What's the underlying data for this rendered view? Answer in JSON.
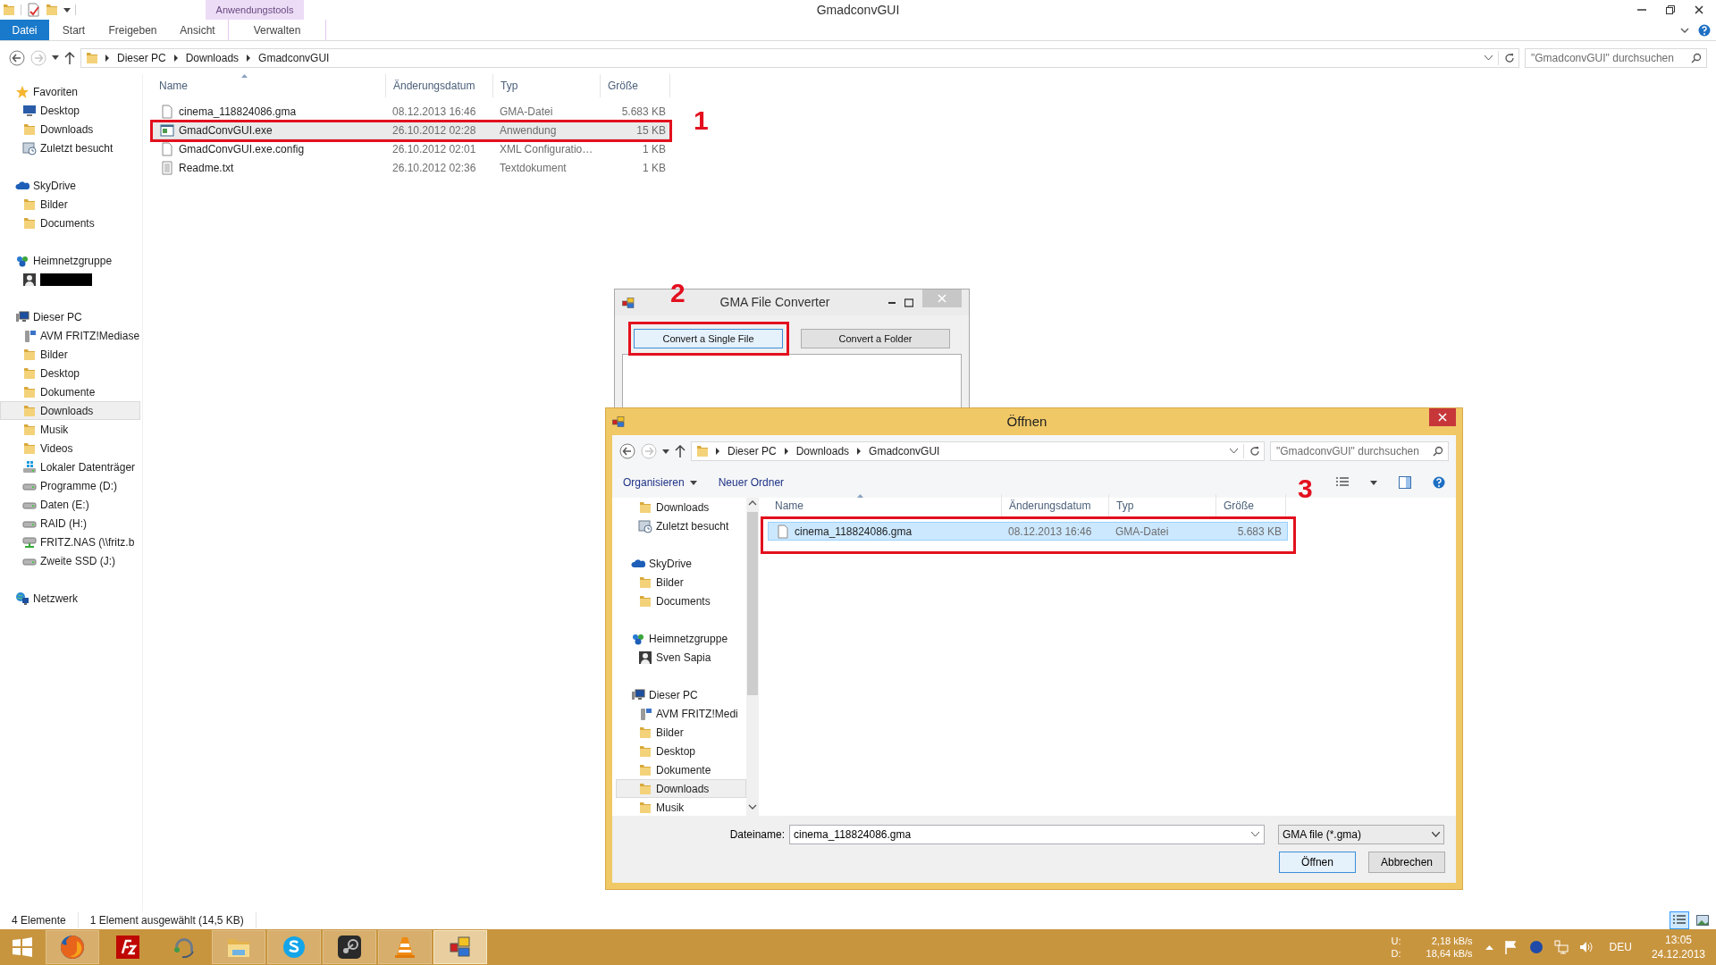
{
  "window": {
    "title": "GmadconvGUI",
    "context_group": "Anwendungstools"
  },
  "ribbon_tabs": [
    {
      "label": "Datei",
      "kind": "file",
      "selected": false
    },
    {
      "label": "Start",
      "kind": "tab",
      "selected": false
    },
    {
      "label": "Freigeben",
      "kind": "tab",
      "selected": false
    },
    {
      "label": "Ansicht",
      "kind": "tab",
      "selected": false
    },
    {
      "label": "Verwalten",
      "kind": "context",
      "selected": false
    }
  ],
  "address": {
    "path": [
      "Dieser PC",
      "Downloads",
      "GmadconvGUI"
    ],
    "search_placeholder": "\"GmadconvGUI\" durchsuchen"
  },
  "sidebar": [
    {
      "label": "Favoriten",
      "kind": "star",
      "selected": false,
      "children": [
        {
          "label": "Desktop",
          "kind": "desktop",
          "selected": false
        },
        {
          "label": "Downloads",
          "kind": "folder",
          "selected": false
        },
        {
          "label": "Zuletzt besucht",
          "kind": "recent",
          "selected": false
        }
      ]
    },
    {
      "label": "SkyDrive",
      "kind": "cloud",
      "selected": false,
      "children": [
        {
          "label": "Bilder",
          "kind": "folder",
          "selected": false
        },
        {
          "label": "Documents",
          "kind": "folder",
          "selected": false
        }
      ]
    },
    {
      "label": "Heimnetzgruppe",
      "kind": "homegroup",
      "selected": false,
      "children": [
        {
          "kind": "user",
          "redacted": true,
          "selected": false
        }
      ]
    },
    {
      "label": "Dieser PC",
      "kind": "pc",
      "selected": false,
      "children": [
        {
          "label": "AVM FRITZ!Mediase",
          "kind": "media",
          "selected": false
        },
        {
          "label": "Bilder",
          "kind": "folder",
          "selected": false
        },
        {
          "label": "Desktop",
          "kind": "folder",
          "selected": false
        },
        {
          "label": "Dokumente",
          "kind": "folder",
          "selected": false
        },
        {
          "label": "Downloads",
          "kind": "folder",
          "selected": true
        },
        {
          "label": "Musik",
          "kind": "folder",
          "selected": false
        },
        {
          "label": "Videos",
          "kind": "folder",
          "selected": false
        },
        {
          "label": "Lokaler Datenträger",
          "kind": "windrive",
          "selected": false
        },
        {
          "label": "Programme (D:)",
          "kind": "drive",
          "selected": false
        },
        {
          "label": "Daten (E:)",
          "kind": "drive",
          "selected": false
        },
        {
          "label": "RAID (H:)",
          "kind": "drive",
          "selected": false
        },
        {
          "label": "FRITZ.NAS (\\\\fritz.b",
          "kind": "nas",
          "selected": false
        },
        {
          "label": "Zweite SSD (J:)",
          "kind": "drive",
          "selected": false
        }
      ]
    },
    {
      "label": "Netzwerk",
      "kind": "network",
      "selected": false
    }
  ],
  "columns": [
    "Name",
    "Änderungsdatum",
    "Typ",
    "Größe"
  ],
  "files": [
    {
      "name": "cinema_118824086.gma",
      "date": "08.12.2013 16:46",
      "type": "GMA-Datei",
      "size": "5.683 KB",
      "kind": "file",
      "selected": false
    },
    {
      "name": "GmadConvGUI.exe",
      "date": "26.10.2012 02:28",
      "type": "Anwendung",
      "size": "15 KB",
      "kind": "app",
      "selected": true
    },
    {
      "name": "GmadConvGUI.exe.config",
      "date": "26.10.2012 02:01",
      "type": "XML Configuratio…",
      "size": "1 KB",
      "kind": "file",
      "selected": false
    },
    {
      "name": "Readme.txt",
      "date": "26.10.2012 02:36",
      "type": "Textdokument",
      "size": "1 KB",
      "kind": "text",
      "selected": false
    }
  ],
  "status_bar": {
    "items": [
      "4 Elemente",
      "1 Element ausgewählt (14,5 KB)"
    ],
    "views": [
      {
        "kind": "details",
        "selected": true
      },
      {
        "kind": "preview",
        "selected": false
      }
    ]
  },
  "converter": {
    "title": "GMA File Converter",
    "buttons": [
      {
        "label": "Convert a Single File",
        "focused": true
      },
      {
        "label": "Convert a Folder",
        "focused": false
      }
    ]
  },
  "dialog": {
    "title": "Öffnen",
    "path": [
      "Dieser PC",
      "Downloads",
      "GmadconvGUI"
    ],
    "search_placeholder": "\"GmadconvGUI\" durchsuchen",
    "toolbar": [
      {
        "label": "Organisieren",
        "kind": "menu"
      },
      {
        "label": "Neuer Ordner",
        "kind": "button"
      }
    ],
    "sidebar": [
      {
        "children": [
          {
            "label": "Downloads",
            "kind": "folder",
            "selected": false
          },
          {
            "label": "Zuletzt besucht",
            "kind": "recent",
            "selected": false
          }
        ]
      },
      {
        "label": "SkyDrive",
        "kind": "cloud",
        "selected": false,
        "children": [
          {
            "label": "Bilder",
            "kind": "folder",
            "selected": false
          },
          {
            "label": "Documents",
            "kind": "folder",
            "selected": false
          }
        ]
      },
      {
        "label": "Heimnetzgruppe",
        "kind": "homegroup",
        "selected": false,
        "children": [
          {
            "label": "Sven Sapia",
            "kind": "user",
            "selected": false
          }
        ]
      },
      {
        "label": "Dieser PC",
        "kind": "pc",
        "selected": false,
        "children": [
          {
            "label": "AVM FRITZ!Medi",
            "kind": "media",
            "selected": false
          },
          {
            "label": "Bilder",
            "kind": "folder",
            "selected": false
          },
          {
            "label": "Desktop",
            "kind": "folder",
            "selected": false
          },
          {
            "label": "Dokumente",
            "kind": "folder",
            "selected": false
          },
          {
            "label": "Downloads",
            "kind": "folder",
            "selected": true
          },
          {
            "label": "Musik",
            "kind": "folder",
            "selected": false
          }
        ]
      }
    ],
    "columns": [
      "Name",
      "Änderungsdatum",
      "Typ",
      "Größe"
    ],
    "files": [
      {
        "name": "cinema_118824086.gma",
        "date": "08.12.2013 16:46",
        "type": "GMA-Datei",
        "size": "5.683 KB",
        "kind": "file",
        "selected": true
      }
    ],
    "filename_label": "Dateiname:",
    "filename": "cinema_118824086.gma",
    "filter": "GMA file (*.gma)",
    "buttons": [
      {
        "label": "Öffnen",
        "default": true
      },
      {
        "label": "Abbrechen",
        "default": false
      }
    ]
  },
  "annotations": [
    {
      "label": "1"
    },
    {
      "label": "2"
    },
    {
      "label": "3"
    }
  ],
  "taskbar": {
    "apps": [
      {
        "kind": "firefox",
        "running": true,
        "active": false
      },
      {
        "kind": "filezilla",
        "running": false,
        "active": false
      },
      {
        "kind": "teamspeak",
        "running": false,
        "active": false
      },
      {
        "kind": "explorer",
        "running": true,
        "active": false
      },
      {
        "kind": "skype",
        "running": true,
        "active": false
      },
      {
        "kind": "steam",
        "running": true,
        "active": false
      },
      {
        "kind": "vlc",
        "running": true,
        "active": false
      },
      {
        "kind": "converter",
        "running": true,
        "active": true
      }
    ],
    "tray": {
      "up_label": "U:",
      "up": "2,18 kB/s",
      "down_label": "D:",
      "down": "18,64 kB/s",
      "language": "DEU",
      "time": "13:05",
      "date": "24.12.2013"
    }
  }
}
